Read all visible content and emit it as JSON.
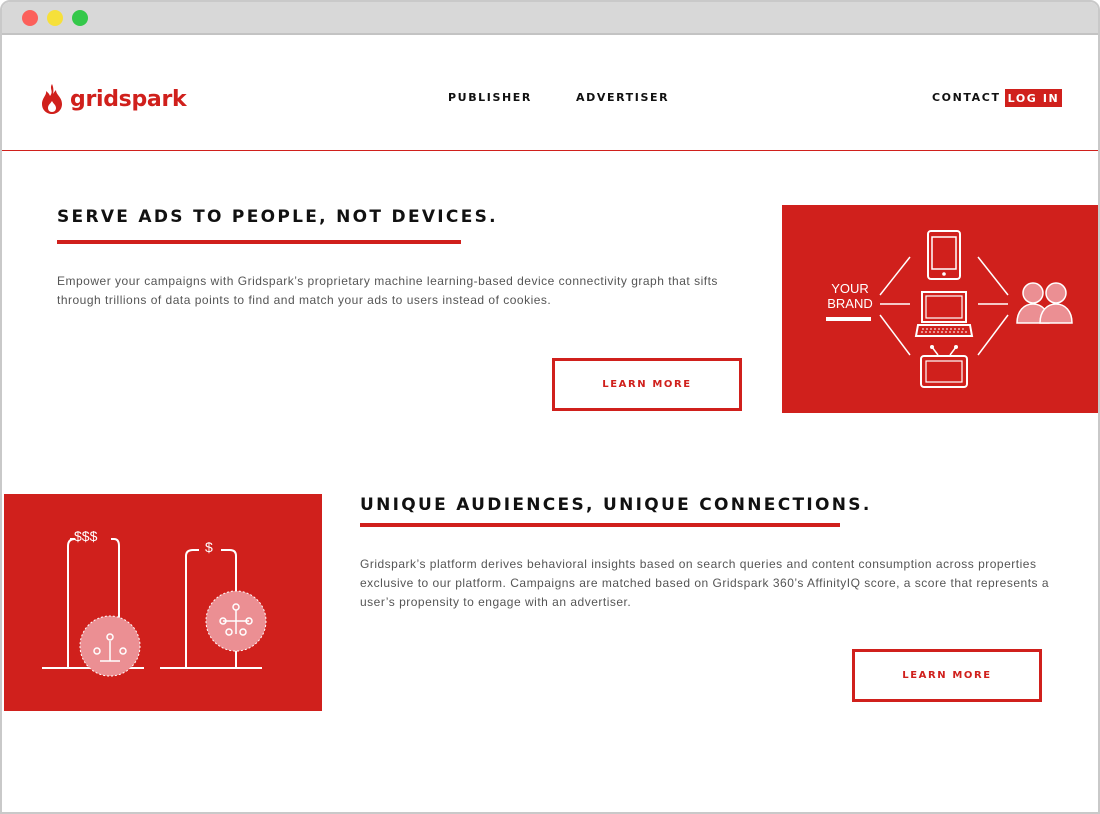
{
  "window": {
    "controls": [
      "close",
      "minimize",
      "maximize"
    ]
  },
  "brand": {
    "name": "gridspark",
    "color": "#d0201c",
    "logo_icon": "flame-icon"
  },
  "nav": {
    "publisher": "PUBLISHER",
    "advertiser": "ADVERTISER",
    "contact": "CONTACT",
    "login": "LOG IN"
  },
  "section1": {
    "headline": "SERVE ADS TO PEOPLE, NOT DEVICES.",
    "body": "Empower your campaigns with Gridspark’s proprietary machine learning-based device connectivity graph that sifts through trillions of data points to find and match your ads to users instead of cookies.",
    "button": "LEARN MORE",
    "graphic": {
      "label": "YOUR BRAND",
      "icons": [
        "tablet-icon",
        "laptop-icon",
        "tv-icon",
        "users-icon"
      ]
    }
  },
  "section2": {
    "headline": "UNIQUE AUDIENCES, UNIQUE CONNECTIONS.",
    "body": "Gridspark’s platform derives behavioral insights based on search queries and content consumption across properties exclusive to our platform. Campaigns are matched based on Gridspark 360’s AffinityIQ score, a score that represents a user’s propensity to engage with an advertiser.",
    "button": "LEARN MORE",
    "graphic": {
      "left_label": "$$$",
      "right_label": "$",
      "icons": [
        "audience-badge-icon",
        "audience-badge-icon"
      ]
    }
  }
}
